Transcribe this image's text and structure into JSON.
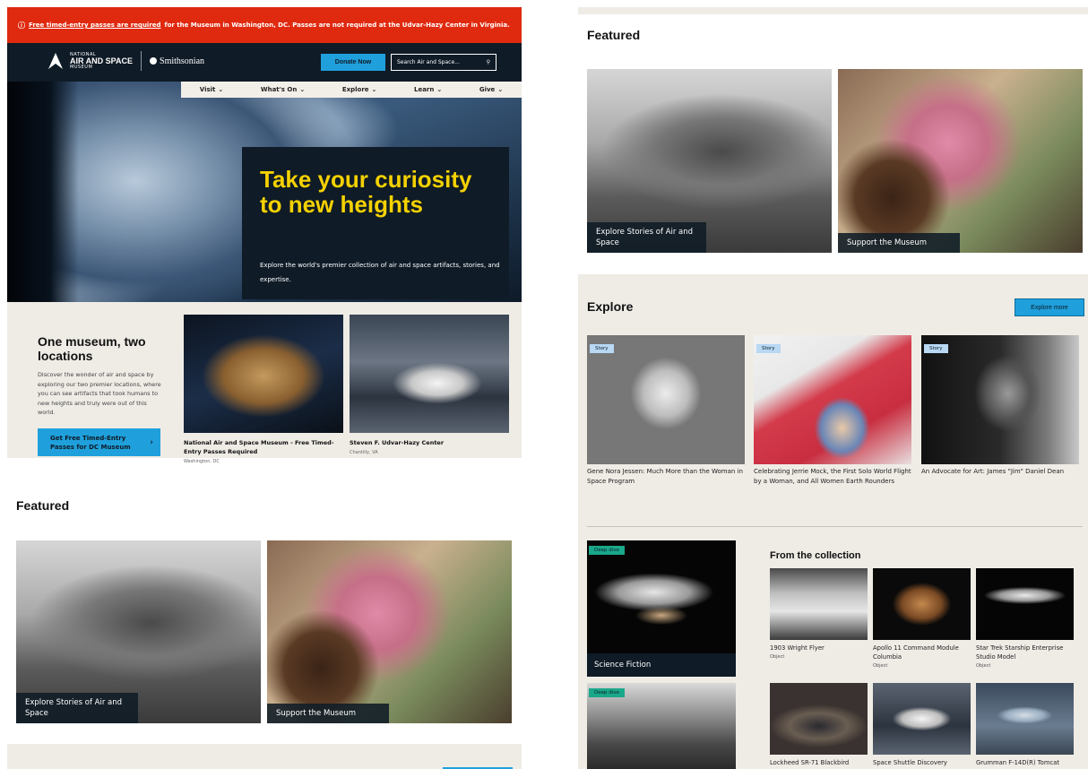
{
  "alert": {
    "icon": "info-circle-icon",
    "link_text": "Free timed-entry passes are required",
    "text": "for the Museum in Washington, DC. Passes are not required at the Udvar-Hazy Center in Virginia."
  },
  "header": {
    "logo_small": "NATIONAL",
    "logo_big": "AIR AND SPACE",
    "logo_small2": "MUSEUM",
    "smithsonian": "Smithsonian",
    "donate_label": "Donate Now",
    "search_placeholder": "Search Air and Space..."
  },
  "nav": {
    "items": [
      "Visit",
      "What's On",
      "Explore",
      "Learn",
      "Give"
    ]
  },
  "hero": {
    "title": "Take your curiosity to new heights",
    "subtitle": "Explore the world's premier collection of air and space artifacts, stories, and expertise."
  },
  "locations": {
    "title": "One museum, two locations",
    "text": "Discover the wonder of air and space by exploring our two premier locations, where you can see artifacts that took humans to new heights and truly were out of this world.",
    "button": "Get Free Timed-Entry Passes for DC Museum",
    "cards": [
      {
        "name": "National Air and Space Museum - Free Timed-Entry Passes Required",
        "place": "Washington, DC"
      },
      {
        "name": "Steven F. Udvar-Hazy Center",
        "place": "Chantilly, VA"
      }
    ]
  },
  "featured": {
    "title": "Featured",
    "cards": [
      {
        "label": "Explore Stories of Air and Space"
      },
      {
        "label": "Support the Museum"
      }
    ]
  },
  "explore": {
    "title": "Explore",
    "button": "Explore more",
    "stories": [
      {
        "tag": "Story",
        "caption": "Gene Nora Jessen: Much More than the Woman in Space Program"
      },
      {
        "tag": "Story",
        "caption": "Celebrating Jerrie Mock, the First Solo World Flight by a Woman, and All Women Earth Rounders"
      },
      {
        "tag": "Story",
        "caption": "An Advocate for Art: James \"Jim\" Daniel Dean"
      }
    ],
    "deep_dives": [
      {
        "tag": "Deep dive",
        "label": "Science Fiction"
      },
      {
        "tag": "Deep dive",
        "label": ""
      }
    ],
    "collection_title": "From the collection",
    "collection": [
      {
        "name": "1903 Wright Flyer",
        "type": "Object"
      },
      {
        "name": "Apollo 11 Command Module Columbia",
        "type": "Object"
      },
      {
        "name": "Star Trek Starship Enterprise Studio Model",
        "type": "Object"
      },
      {
        "name": "Lockheed SR-71 Blackbird",
        "type": ""
      },
      {
        "name": "Space Shuttle Discovery",
        "type": ""
      },
      {
        "name": "Grumman F-14D(R) Tomcat",
        "type": ""
      }
    ]
  },
  "colors": {
    "alert_red": "#e02a10",
    "navy": "#0f1b26",
    "accent_blue": "#1fa0dc",
    "hero_yellow": "#f4d100",
    "beige": "#efece6",
    "deep_dive_green": "#1aa88a",
    "story_tag_blue": "#b8d8f4"
  }
}
